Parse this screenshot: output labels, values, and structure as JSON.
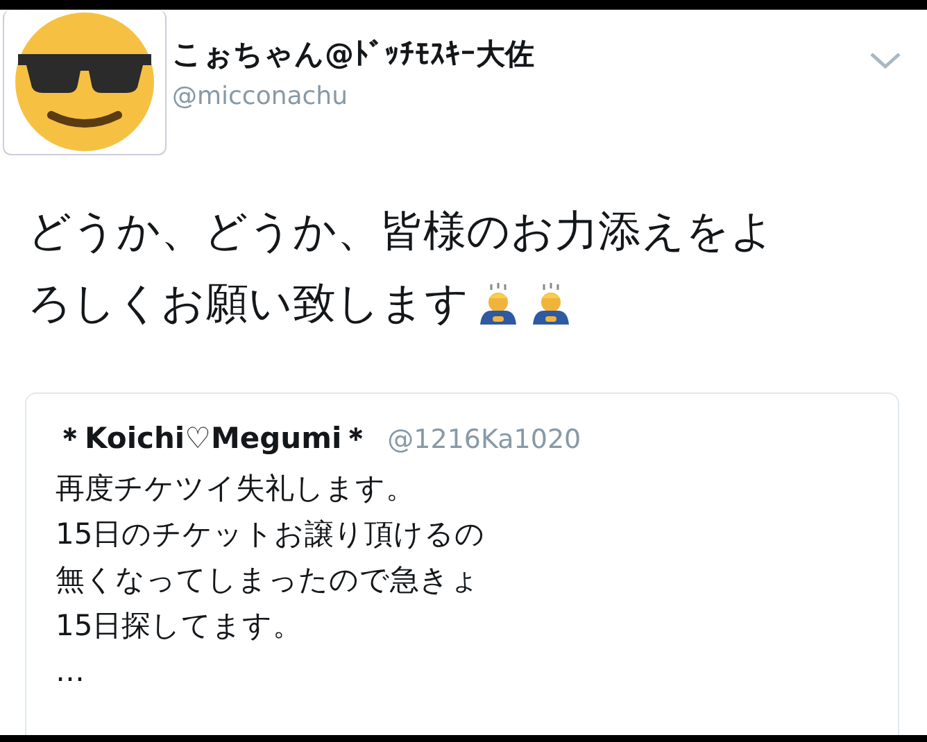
{
  "tweet": {
    "display_name": "こぉちゃん@ﾄﾞｯﾁﾓｽｷｰ大佐",
    "handle": "@micconachu",
    "text_lines": [
      "どうか、どうか、皆様のお力添えをよ",
      "ろしくお願い致します"
    ],
    "quoted_tweet": {
      "display_name": "＊Koichi♡Megumi＊",
      "handle": "@1216Ka1020",
      "text_lines": [
        "再度チケツイ失礼します。",
        "15日のチケットお譲り頂けるの",
        "無くなってしまったので急きょ",
        "15日探してます。",
        "…"
      ]
    }
  }
}
